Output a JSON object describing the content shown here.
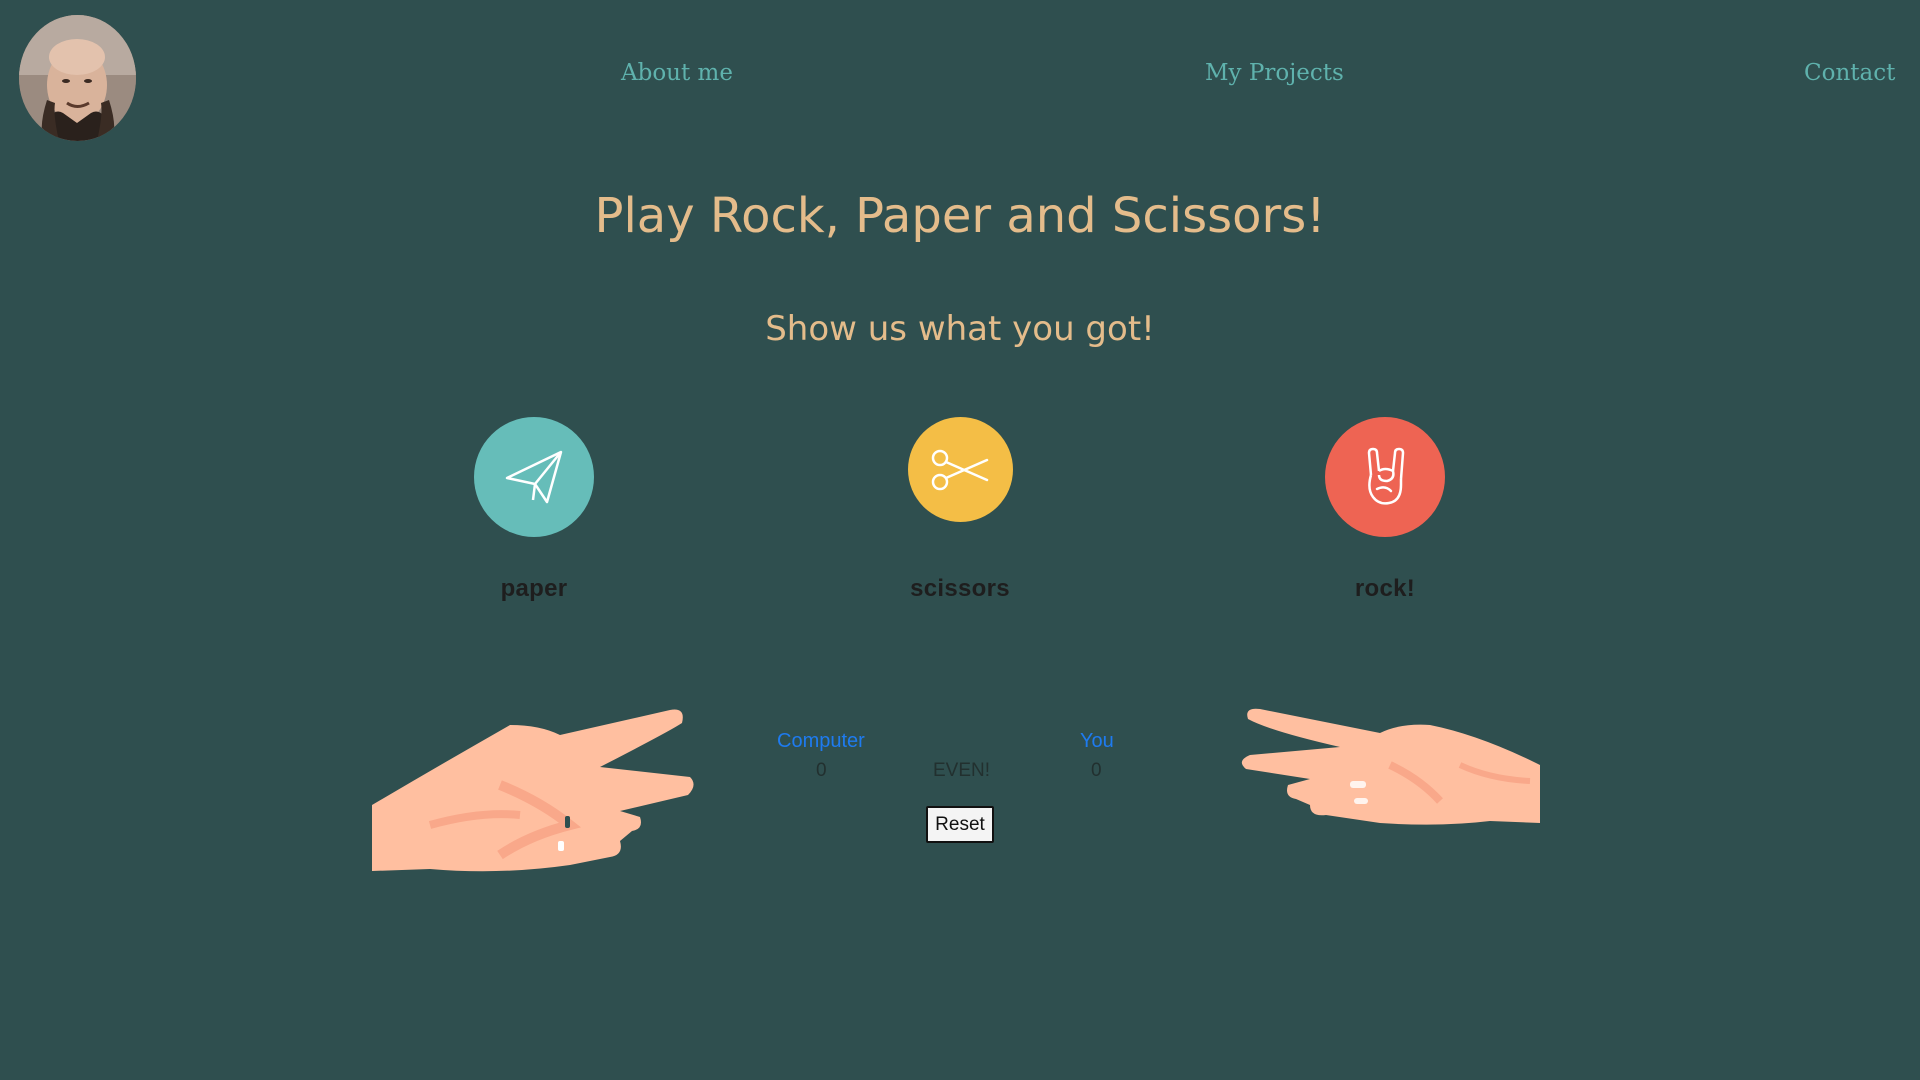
{
  "nav": {
    "about": "About me",
    "projects": "My Projects",
    "contact": "Contact"
  },
  "game": {
    "title": "Play Rock, Paper and Scissors!",
    "subtitle": "Show us what you got!",
    "choices": {
      "paper": "paper",
      "scissors": "scissors",
      "rock": "rock!"
    }
  },
  "score": {
    "computer_label": "Computer",
    "you_label": "You",
    "computer_value": "0",
    "you_value": "0",
    "result": "EVEN!",
    "reset_label": "Reset"
  },
  "colors": {
    "background": "#2f4f4f",
    "heading": "#e4bc8b",
    "nav": "#5fb2ad",
    "paper": "#66bdb9",
    "scissors": "#f4be46",
    "rock": "#ee6453",
    "score_label": "#1e7bf0"
  },
  "icons": [
    "paper-plane-icon",
    "scissors-icon",
    "rock-hand-icon"
  ]
}
